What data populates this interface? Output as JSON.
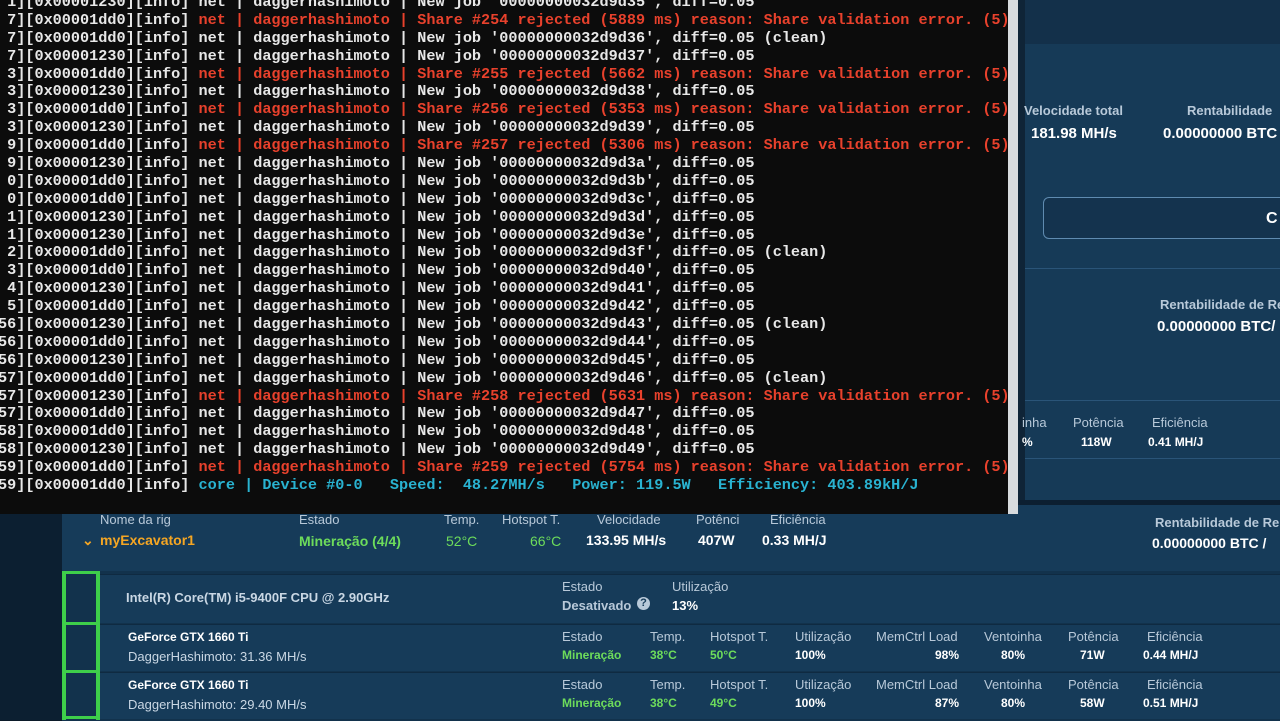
{
  "terminal": {
    "lines": [
      {
        "prefix": "1]",
        "tid": "[0x00001230]",
        "lvl": "[info]",
        "src": "net",
        "algo": "daggerhashimoto",
        "msg": "New job '00000000032d9d35', diff=0.05",
        "err": false
      },
      {
        "prefix": "7]",
        "tid": "[0x00001dd0]",
        "lvl": "[info]",
        "src": "net",
        "algo": "daggerhashimoto",
        "msg": "Share #254 rejected (5889 ms) reason: Share validation error. (5)",
        "err": true
      },
      {
        "prefix": "7]",
        "tid": "[0x00001dd0]",
        "lvl": "[info]",
        "src": "net",
        "algo": "daggerhashimoto",
        "msg": "New job '00000000032d9d36', diff=0.05 (clean)",
        "err": false
      },
      {
        "prefix": "7]",
        "tid": "[0x00001230]",
        "lvl": "[info]",
        "src": "net",
        "algo": "daggerhashimoto",
        "msg": "New job '00000000032d9d37', diff=0.05",
        "err": false
      },
      {
        "prefix": "3]",
        "tid": "[0x00001dd0]",
        "lvl": "[info]",
        "src": "net",
        "algo": "daggerhashimoto",
        "msg": "Share #255 rejected (5662 ms) reason: Share validation error. (5)",
        "err": true
      },
      {
        "prefix": "3]",
        "tid": "[0x00001230]",
        "lvl": "[info]",
        "src": "net",
        "algo": "daggerhashimoto",
        "msg": "New job '00000000032d9d38', diff=0.05",
        "err": false
      },
      {
        "prefix": "3]",
        "tid": "[0x00001dd0]",
        "lvl": "[info]",
        "src": "net",
        "algo": "daggerhashimoto",
        "msg": "Share #256 rejected (5353 ms) reason: Share validation error. (5)",
        "err": true
      },
      {
        "prefix": "3]",
        "tid": "[0x00001230]",
        "lvl": "[info]",
        "src": "net",
        "algo": "daggerhashimoto",
        "msg": "New job '00000000032d9d39', diff=0.05",
        "err": false
      },
      {
        "prefix": "9]",
        "tid": "[0x00001dd0]",
        "lvl": "[info]",
        "src": "net",
        "algo": "daggerhashimoto",
        "msg": "Share #257 rejected (5306 ms) reason: Share validation error. (5)",
        "err": true
      },
      {
        "prefix": "9]",
        "tid": "[0x00001230]",
        "lvl": "[info]",
        "src": "net",
        "algo": "daggerhashimoto",
        "msg": "New job '00000000032d9d3a', diff=0.05",
        "err": false
      },
      {
        "prefix": "0]",
        "tid": "[0x00001dd0]",
        "lvl": "[info]",
        "src": "net",
        "algo": "daggerhashimoto",
        "msg": "New job '00000000032d9d3b', diff=0.05",
        "err": false
      },
      {
        "prefix": "0]",
        "tid": "[0x00001dd0]",
        "lvl": "[info]",
        "src": "net",
        "algo": "daggerhashimoto",
        "msg": "New job '00000000032d9d3c', diff=0.05",
        "err": false
      },
      {
        "prefix": "1]",
        "tid": "[0x00001230]",
        "lvl": "[info]",
        "src": "net",
        "algo": "daggerhashimoto",
        "msg": "New job '00000000032d9d3d', diff=0.05",
        "err": false
      },
      {
        "prefix": "1]",
        "tid": "[0x00001230]",
        "lvl": "[info]",
        "src": "net",
        "algo": "daggerhashimoto",
        "msg": "New job '00000000032d9d3e', diff=0.05",
        "err": false
      },
      {
        "prefix": "2]",
        "tid": "[0x00001dd0]",
        "lvl": "[info]",
        "src": "net",
        "algo": "daggerhashimoto",
        "msg": "New job '00000000032d9d3f', diff=0.05 (clean)",
        "err": false
      },
      {
        "prefix": "3]",
        "tid": "[0x00001dd0]",
        "lvl": "[info]",
        "src": "net",
        "algo": "daggerhashimoto",
        "msg": "New job '00000000032d9d40', diff=0.05",
        "err": false
      },
      {
        "prefix": "4]",
        "tid": "[0x00001230]",
        "lvl": "[info]",
        "src": "net",
        "algo": "daggerhashimoto",
        "msg": "New job '00000000032d9d41', diff=0.05",
        "err": false
      },
      {
        "prefix": "5]",
        "tid": "[0x00001dd0]",
        "lvl": "[info]",
        "src": "net",
        "algo": "daggerhashimoto",
        "msg": "New job '00000000032d9d42', diff=0.05",
        "err": false
      },
      {
        "prefix": "56]",
        "tid": "[0x00001230]",
        "lvl": "[info]",
        "src": "net",
        "algo": "daggerhashimoto",
        "msg": "New job '00000000032d9d43', diff=0.05 (clean)",
        "err": false
      },
      {
        "prefix": "56]",
        "tid": "[0x00001dd0]",
        "lvl": "[info]",
        "src": "net",
        "algo": "daggerhashimoto",
        "msg": "New job '00000000032d9d44', diff=0.05",
        "err": false
      },
      {
        "prefix": "56]",
        "tid": "[0x00001230]",
        "lvl": "[info]",
        "src": "net",
        "algo": "daggerhashimoto",
        "msg": "New job '00000000032d9d45', diff=0.05",
        "err": false
      },
      {
        "prefix": "57]",
        "tid": "[0x00001dd0]",
        "lvl": "[info]",
        "src": "net",
        "algo": "daggerhashimoto",
        "msg": "New job '00000000032d9d46', diff=0.05 (clean)",
        "err": false
      },
      {
        "prefix": "57]",
        "tid": "[0x00001230]",
        "lvl": "[info]",
        "src": "net",
        "algo": "daggerhashimoto",
        "msg": "Share #258 rejected (5631 ms) reason: Share validation error. (5)",
        "err": true
      },
      {
        "prefix": "57]",
        "tid": "[0x00001dd0]",
        "lvl": "[info]",
        "src": "net",
        "algo": "daggerhashimoto",
        "msg": "New job '00000000032d9d47', diff=0.05",
        "err": false
      },
      {
        "prefix": "58]",
        "tid": "[0x00001dd0]",
        "lvl": "[info]",
        "src": "net",
        "algo": "daggerhashimoto",
        "msg": "New job '00000000032d9d48', diff=0.05",
        "err": false
      },
      {
        "prefix": "58]",
        "tid": "[0x00001230]",
        "lvl": "[info]",
        "src": "net",
        "algo": "daggerhashimoto",
        "msg": "New job '00000000032d9d49', diff=0.05",
        "err": false
      },
      {
        "prefix": "59]",
        "tid": "[0x00001dd0]",
        "lvl": "[info]",
        "src": "net",
        "algo": "daggerhashimoto",
        "msg": "Share #259 rejected (5754 ms) reason: Share validation error. (5)",
        "err": true
      }
    ],
    "status_line": {
      "prefix": "59][0x00001dd0][info]",
      "text": "core | Device #0-0   Speed:  48.27MH/s   Power: 119.5W   Efficiency: 403.89kH/J"
    }
  },
  "summary": {
    "total_speed_label": "Velocidade total",
    "total_speed_value": "181.98 MH/s",
    "profit_label": "Rentabilidade",
    "profit_value": "0.00000000 BTC",
    "button_partial": "C"
  },
  "profit_panel": {
    "label": "Rentabilidade de Re",
    "value": "0.00000000 BTC/"
  },
  "mini_stats": {
    "util_label": "inha",
    "util_value": "%",
    "power_label": "Potência",
    "power_value": "118W",
    "eff_label": "Eficiência",
    "eff_value": "0.41 MH/J"
  },
  "rig": {
    "headers": {
      "name": "Nome da rig",
      "state": "Estado",
      "temp": "Temp.",
      "hotspot": "Hotspot T.",
      "speed": "Velocidade",
      "power": "Potênci",
      "eff": "Eficiência",
      "profit": "Rentabilidade de Re"
    },
    "name": "myExcavator1",
    "state": "Mineração (4/4)",
    "temp": "52°C",
    "hotspot": "66°C",
    "speed": "133.95 MH/s",
    "power": "407W",
    "eff": "0.33 MH/J",
    "profit": "0.00000000 BTC /"
  },
  "cpu": {
    "name": "Intel(R) Core(TM) i5-9400F CPU @ 2.90GHz",
    "state_label": "Estado",
    "state_value": "Desativado",
    "util_label": "Utilização",
    "util_value": "13%"
  },
  "gpus": [
    {
      "name": "GeForce GTX 1660 Ti",
      "algo": "DaggerHashimoto: 31.36 MH/s",
      "state_label": "Estado",
      "state": "Mineração",
      "temp_label": "Temp.",
      "temp": "38°C",
      "hotspot_label": "Hotspot T.",
      "hotspot": "50°C",
      "util_label": "Utilização",
      "util": "100%",
      "mem_label": "MemCtrl Load",
      "mem": "98%",
      "fan_label": "Ventoinha",
      "fan": "80%",
      "power_label": "Potência",
      "power": "71W",
      "eff_label": "Eficiência",
      "eff": "0.44 MH/J"
    },
    {
      "name": "GeForce GTX 1660 Ti",
      "algo": "DaggerHashimoto: 29.40 MH/s",
      "state_label": "Estado",
      "state": "Mineração",
      "temp_label": "Temp.",
      "temp": "38°C",
      "hotspot_label": "Hotspot T.",
      "hotspot": "49°C",
      "util_label": "Utilização",
      "util": "100%",
      "mem_label": "MemCtrl Load",
      "mem": "87%",
      "fan_label": "Ventoinha",
      "fan": "80%",
      "power_label": "Potência",
      "power": "58W",
      "eff_label": "Eficiência",
      "eff": "0.51 MH/J"
    }
  ],
  "colors": {
    "terminal_bg": "#0c0c0c",
    "error_red": "#e8412c",
    "core_cyan": "#29b3d1",
    "dashboard_bg": "#163b59",
    "mining_green": "#6ddc5b",
    "warn_orange": "#f5a623"
  }
}
